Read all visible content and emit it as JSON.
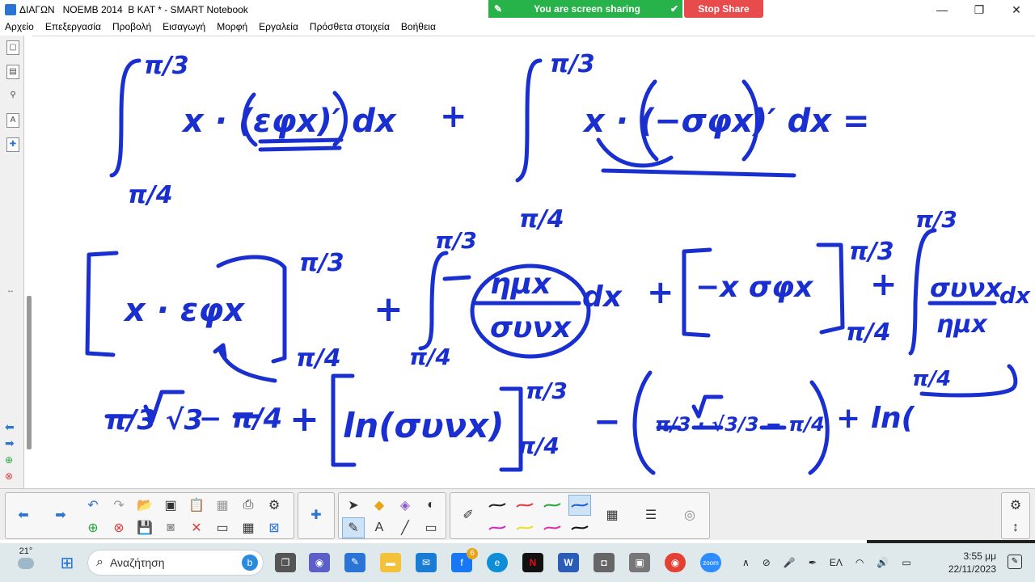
{
  "window": {
    "title": "ΔΙΑΓΩΝ   ΝΟΕΜΒ 2014  Β ΚΑΤ * - SMART Notebook",
    "minimize": "—",
    "restore": "❐",
    "close": "✕"
  },
  "screen_share": {
    "status": "You are screen sharing",
    "stop_label": "Stop Share",
    "accent": "#27b24a",
    "stop_color": "#e84b4b"
  },
  "menu": {
    "items": [
      "Αρχείο",
      "Επεξεργασία",
      "Προβολή",
      "Εισαγωγή",
      "Μορφή",
      "Εργαλεία",
      "Πρόσθετα στοιχεία",
      "Βοήθεια"
    ]
  },
  "ink": {
    "color": "#1a2fd0",
    "row1_left": "x · (εφx)′ dx",
    "row1_plus": "+",
    "row1_right": "x · (−σφx)′ dx =",
    "row1_lim_up": "π/3",
    "row1_lim_low": "π/4",
    "row2_bracket": "x · εφx",
    "row2_plus1": "+",
    "row2_num": "ημx",
    "row2_den": "συνx",
    "row2_dx1": "dx",
    "row2_plus2": "+",
    "row2_bracket2": "−x σφx",
    "row2_plus3": "+",
    "row2_num2": "συνx",
    "row2_den2": "ημx",
    "row2_dx2": "dx",
    "row3_a": "π/3 √3",
    "row3_b": "− π/4",
    "row3_plus": "+",
    "row3_ln": "ln(συνx)",
    "row3_minus": "−",
    "row3_paren": "π/3 · √3/3 − π/4",
    "row3_end": "+ ln(",
    "lim_up": "π/3",
    "lim_low": "π/4"
  },
  "toolbar": {
    "pen_colors": [
      "#222222",
      "#e23b3b",
      "#27a63a",
      "#1f5fd0",
      "#d026c6",
      "#e8e02a",
      "#e02aa8",
      "#111111"
    ]
  },
  "taskbar": {
    "temperature": "21°",
    "search_placeholder": "Αναζήτηση",
    "notification_count": "6",
    "language": "ΕΛ",
    "time": "3:55 μμ",
    "date": "22/11/2023",
    "zoom_label": "zoom"
  }
}
